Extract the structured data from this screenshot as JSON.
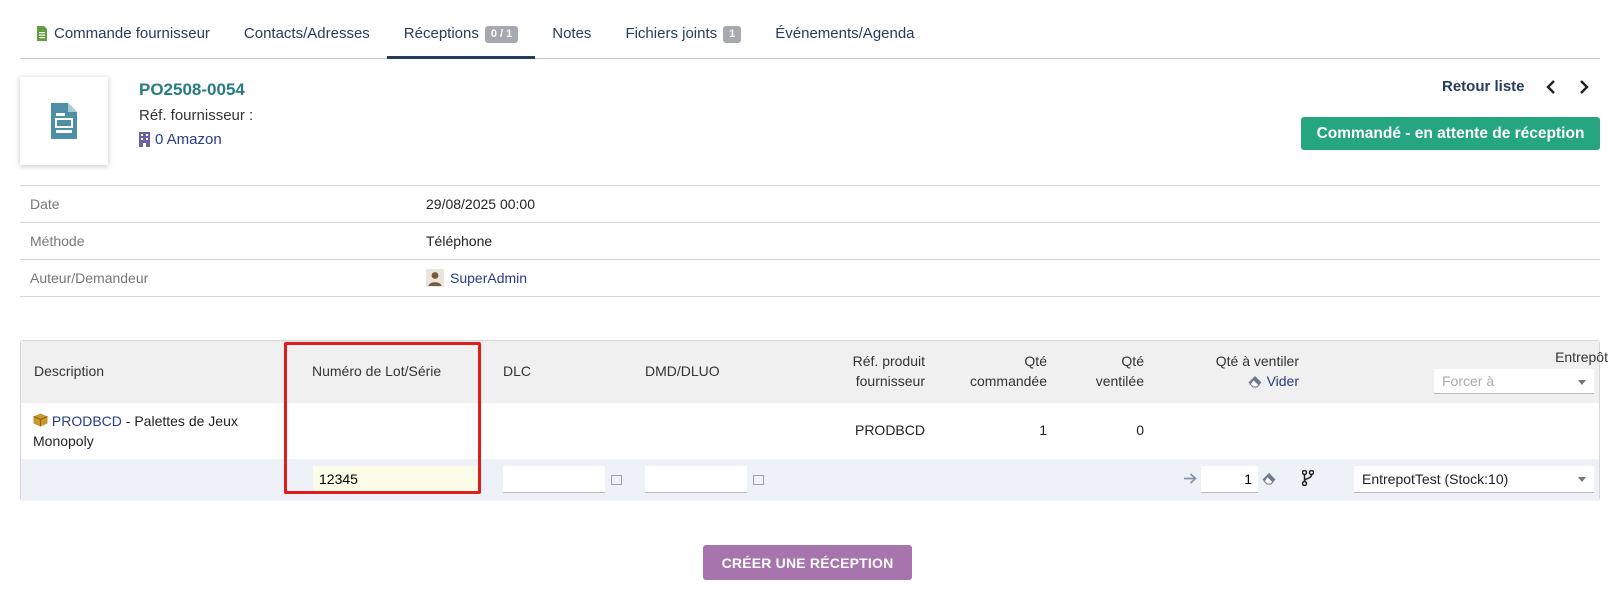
{
  "tabs": [
    {
      "label": "Commande fournisseur",
      "icon": "document-icon"
    },
    {
      "label": "Contacts/Adresses"
    },
    {
      "label": "Réceptions",
      "badge": "0 / 1",
      "active": true
    },
    {
      "label": "Notes"
    },
    {
      "label": "Fichiers joints",
      "badge": "1"
    },
    {
      "label": "Événements/Agenda"
    }
  ],
  "header": {
    "ref": "PO2508-0054",
    "supplier_ref_label": "Réf. fournisseur :",
    "thirdparty": "0 Amazon",
    "back_list": "Retour liste",
    "status": "Commandé - en attente de réception"
  },
  "info": {
    "date_label": "Date",
    "date_value": "29/08/2025 00:00",
    "method_label": "Méthode",
    "method_value": "Téléphone",
    "author_label": "Auteur/Demandeur",
    "author_value": "SuperAdmin"
  },
  "lines": {
    "headers": {
      "description": "Description",
      "lot": "Numéro de Lot/Série",
      "dlc": "DLC",
      "dmd": "DMD/DLUO",
      "ref_fourn_1": "Réf. produit",
      "ref_fourn_2": "fournisseur",
      "qty_ordered_1": "Qté",
      "qty_ordered_2": "commandée",
      "qty_dispatched_1": "Qté",
      "qty_dispatched_2": "ventilée",
      "qty_to_dispatch": "Qté à ventiler",
      "clear": "Vider",
      "warehouse": "Entrepôt",
      "force_placeholder": "Forcer à"
    },
    "row": {
      "product_code": "PRODBCD",
      "product_label_1": " - Palettes de Jeux",
      "product_label_2": "Monopoly",
      "ref_fourn": "PRODBCD",
      "qty_ordered": "1",
      "qty_dispatched": "0"
    },
    "dispatch": {
      "lot_value": "12345",
      "qty_value": "1",
      "warehouse_value": "EntrepotTest (Stock:10)"
    }
  },
  "create_button": "CRÉER UNE RÉCEPTION",
  "colors": {
    "accent": "#263c5c",
    "ref": "#287d82",
    "status": "#25a580",
    "button": "#a874ad",
    "highlight": "#e01c1c"
  }
}
